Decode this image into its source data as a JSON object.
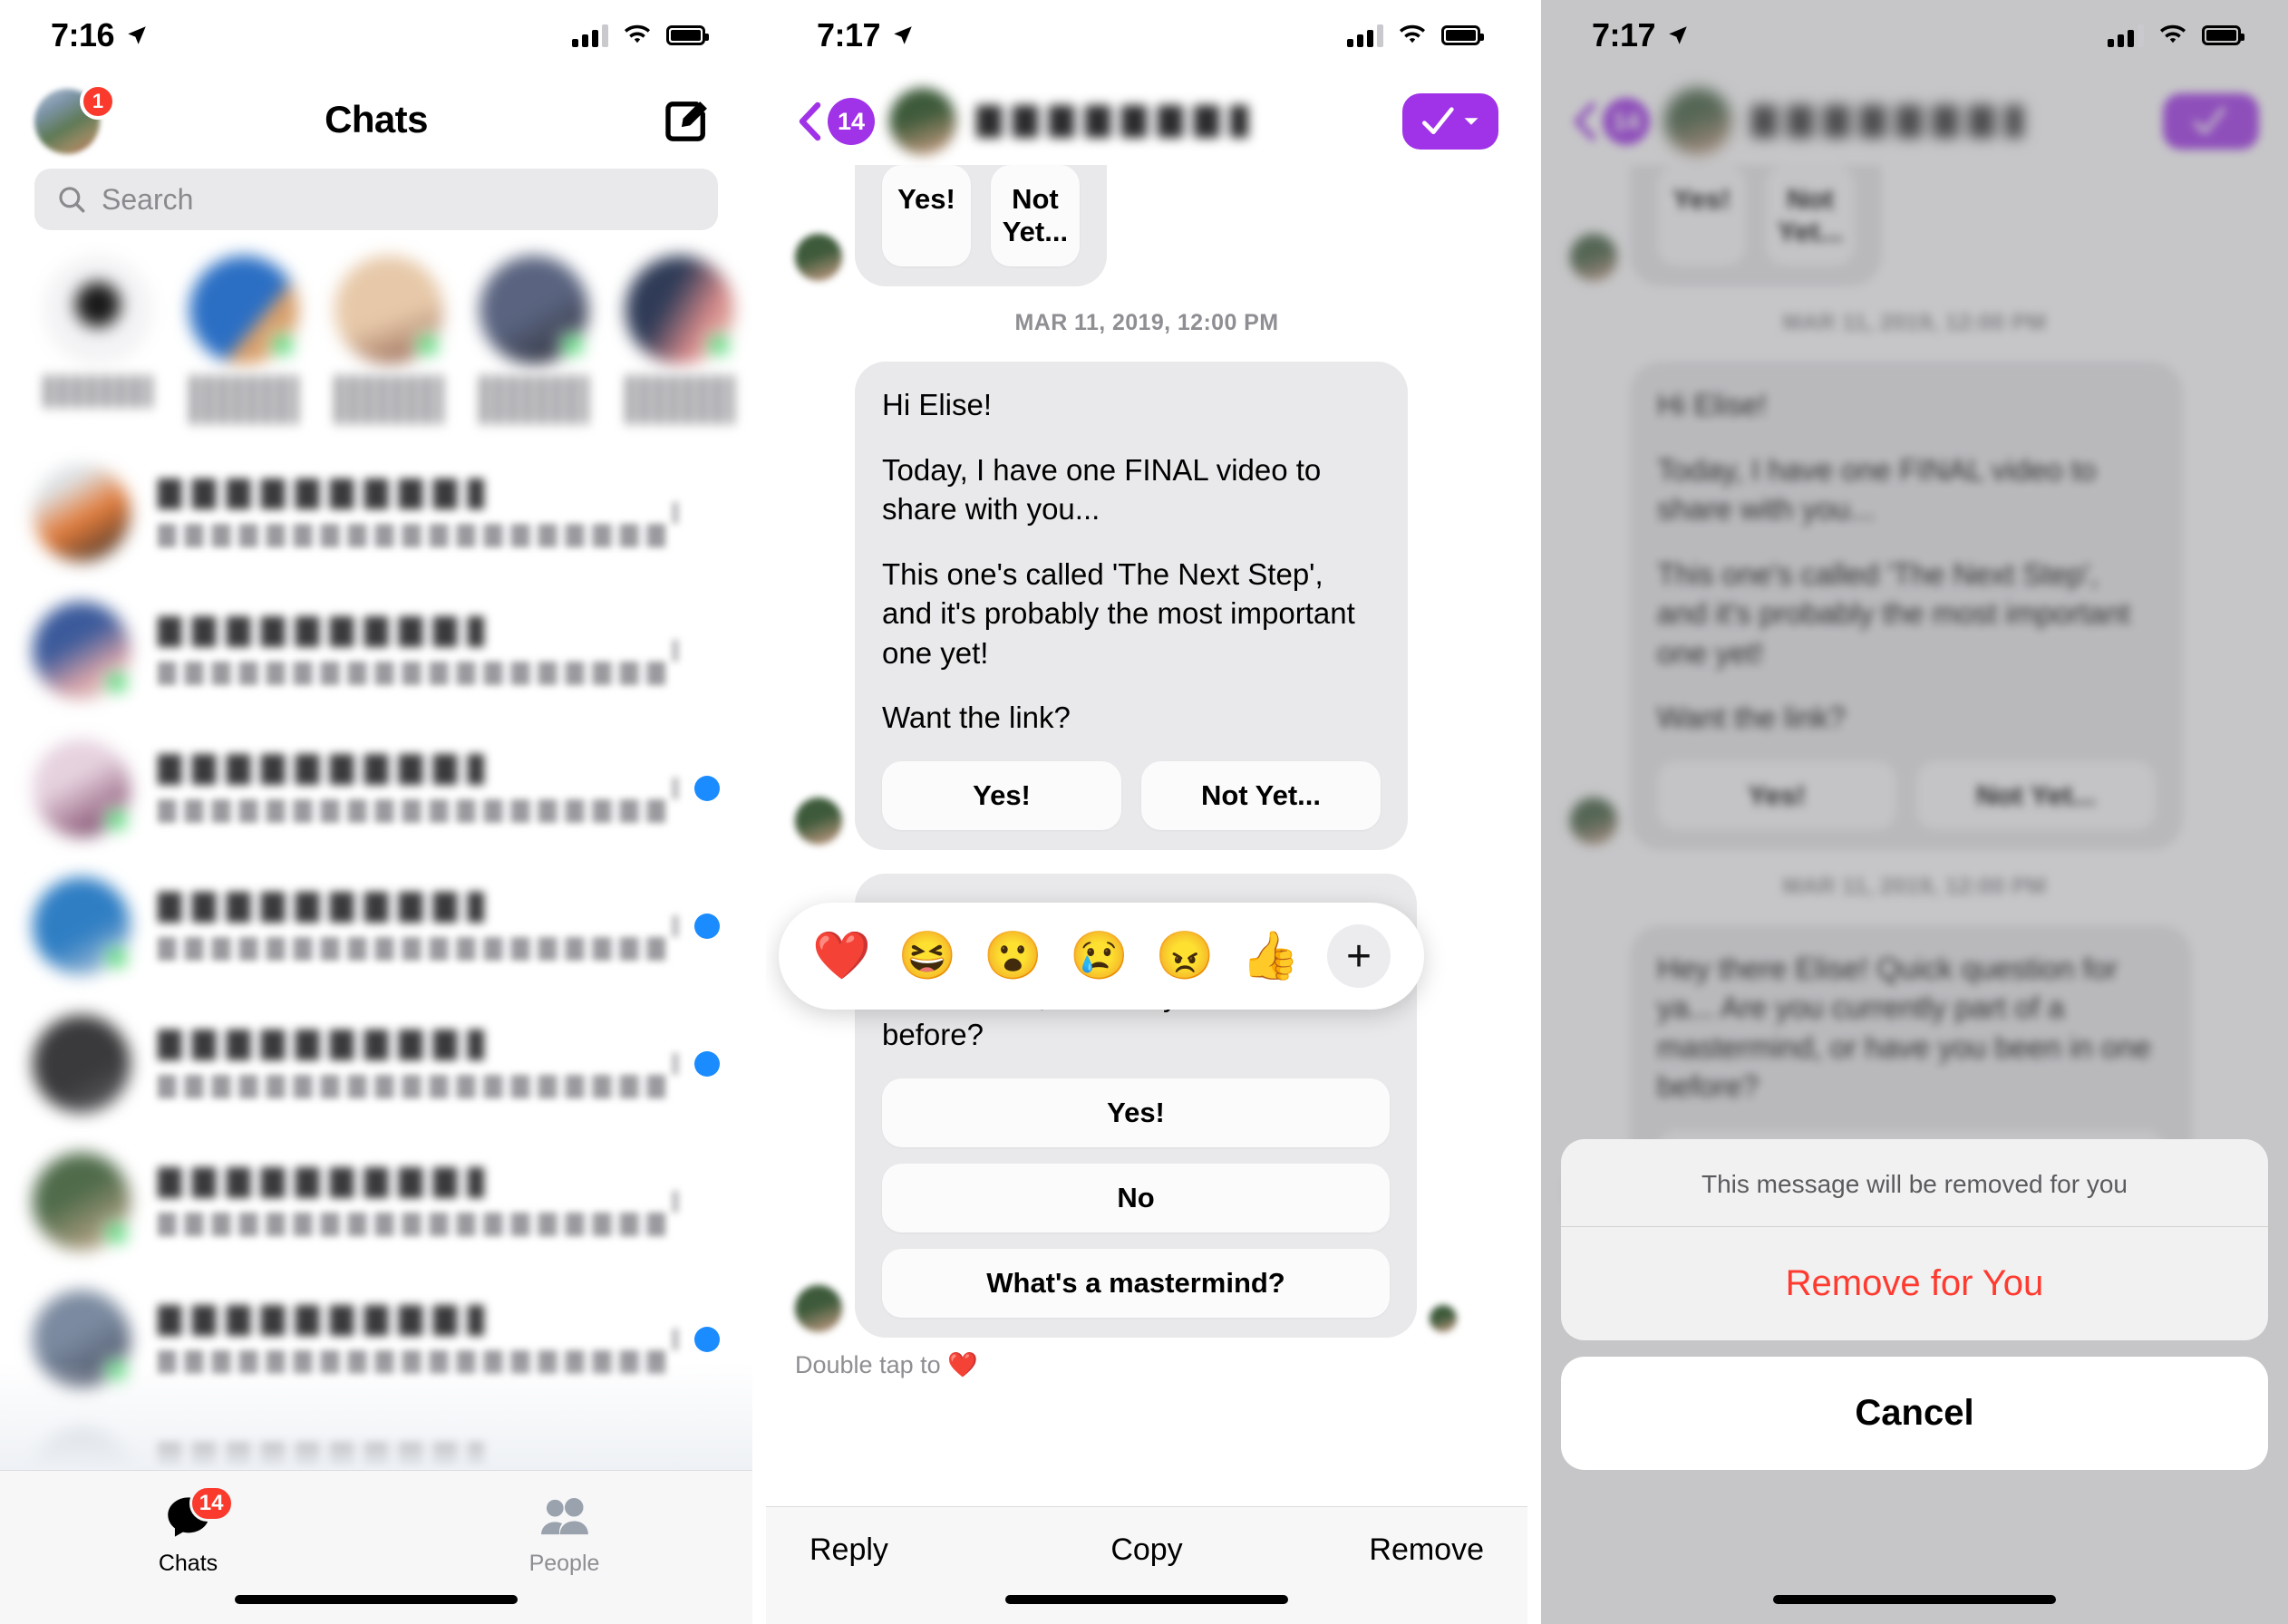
{
  "panels": {
    "chats": {
      "status": {
        "time": "7:16",
        "location_icon": "location-arrow-icon",
        "signal_icon": "cellular-bars-icon",
        "wifi_icon": "wifi-icon",
        "battery_icon": "battery-icon"
      },
      "header": {
        "title": "Chats",
        "avatar_badge": "1",
        "compose_icon": "compose-icon"
      },
      "search": {
        "placeholder": "Search",
        "icon": "search-icon"
      },
      "stories": [
        {
          "name": "",
          "online": false
        },
        {
          "name": "",
          "online": true
        },
        {
          "name": "",
          "online": true
        },
        {
          "name": "",
          "online": true
        },
        {
          "name": "",
          "online": true
        }
      ],
      "rows": [
        {
          "name": "",
          "preview": "",
          "time": "",
          "unread": false,
          "online": false
        },
        {
          "name": "",
          "preview": "",
          "time": "",
          "unread": false,
          "online": true
        },
        {
          "name": "",
          "preview": "",
          "time": "",
          "unread": true,
          "online": true
        },
        {
          "name": "",
          "preview": "",
          "time": "",
          "unread": true,
          "online": true
        },
        {
          "name": "",
          "preview": "",
          "time": "",
          "unread": true,
          "online": false
        },
        {
          "name": "",
          "preview": "",
          "time": "",
          "unread": false,
          "online": true
        },
        {
          "name": "",
          "preview": "",
          "time": "",
          "unread": true,
          "online": true
        }
      ],
      "tabs": [
        {
          "label": "Chats",
          "icon": "chat-bubble-icon",
          "badge": "14",
          "active": true
        },
        {
          "label": "People",
          "icon": "people-icon",
          "badge": "",
          "active": false
        }
      ]
    },
    "thread": {
      "status": {
        "time": "7:17",
        "location_icon": "location-arrow-icon",
        "signal_icon": "cellular-bars-icon",
        "wifi_icon": "wifi-icon",
        "battery_icon": "battery-icon"
      },
      "header": {
        "back_icon": "chevron-left-icon",
        "back_count": "14",
        "contact_name": "",
        "avatar": "contact-avatar",
        "action_icon": "check-mark-icon",
        "action_chevron_icon": "chevron-down-icon",
        "action_color": "#a033e8"
      },
      "partial_quick_replies": [
        "Yes!",
        "Not Yet..."
      ],
      "timestamp_divider": "MAR 11, 2019, 12:00 PM",
      "messages": [
        {
          "paragraphs": [
            "Hi Elise!",
            "Today, I have one FINAL video to share with you...",
            "This one's called 'The Next Step', and it's probably the most important one yet!",
            "Want the link?"
          ],
          "quick_replies": [
            "Yes!",
            "Not Yet..."
          ],
          "layout": "row"
        },
        {
          "paragraphs": [
            "Hey there Elise! Quick question for ya... Are you currently part of a mastermind, or have you been in one before?"
          ],
          "quick_replies": [
            "Yes!",
            "No",
            "What's a mastermind?"
          ],
          "layout": "stack"
        }
      ],
      "double_tap_hint": "Double tap to ❤️",
      "reactions": [
        "❤️",
        "😆",
        "😮",
        "😢",
        "😠",
        "👍"
      ],
      "reaction_add_icon": "plus-icon",
      "action_bar": [
        "Reply",
        "Copy",
        "Remove"
      ]
    },
    "confirm": {
      "status": {
        "time": "7:17",
        "location_icon": "location-arrow-icon",
        "signal_icon": "cellular-bars-icon",
        "wifi_icon": "wifi-icon",
        "battery_icon": "battery-icon"
      },
      "sheet": {
        "message": "This message will be removed for you",
        "destructive_label": "Remove for You",
        "destructive_color": "#ff3b30",
        "cancel_label": "Cancel"
      },
      "background_hint": "Double tap to ❤️"
    }
  },
  "colors": {
    "accent_purple": "#a033e8",
    "unread_blue": "#1a8cff",
    "badge_red": "#fa3a2c",
    "online_green": "#2ed158",
    "bubble_gray": "#e9e9eb",
    "destructive_red": "#ff3b30"
  }
}
